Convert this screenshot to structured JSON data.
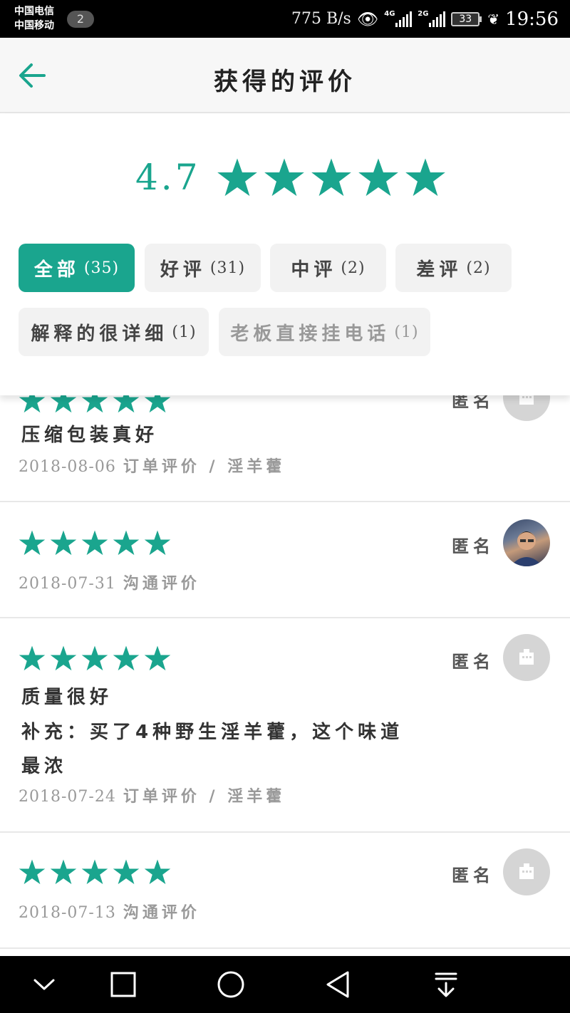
{
  "status_bar": {
    "carrier1": "中国电信",
    "carrier2": "中国移动",
    "notification_count": "2",
    "net_speed": "775 B/s",
    "signal1_tag": "4G",
    "signal2_tag": "2G",
    "battery": "33",
    "time": "19:56"
  },
  "header": {
    "title": "获得的评价"
  },
  "summary": {
    "rating": "4.7",
    "star_count": 5
  },
  "filters": [
    {
      "label": "全部",
      "count": "(35)",
      "active": true
    },
    {
      "label": "好评",
      "count": "(31)"
    },
    {
      "label": "中评",
      "count": "(2)"
    },
    {
      "label": "差评",
      "count": "(2)"
    },
    {
      "label": "解释的很详细",
      "count": "(1)"
    },
    {
      "label": "老板直接挂电话",
      "count": "(1)"
    }
  ],
  "reviews": [
    {
      "stars": 5,
      "name": "匿名",
      "comment": "压缩包装真好",
      "date": "2018-08-06",
      "type": "订单评价 / 淫羊藿"
    },
    {
      "stars": 5,
      "name": "匿名",
      "date": "2018-07-31",
      "type": "沟通评价"
    },
    {
      "stars": 5,
      "name": "匿名",
      "comment": "质量很好",
      "supplement": "补充：买了4种野生淫羊藿，这个味道最浓",
      "date": "2018-07-24",
      "type": "订单评价 / 淫羊藿"
    },
    {
      "stars": 5,
      "name": "匿名",
      "date": "2018-07-13",
      "type": "沟通评价"
    }
  ],
  "colors": {
    "accent": "#1aa58e",
    "chip_bg": "#f2f2f2"
  },
  "icons": [
    "back-arrow-icon",
    "star-icon",
    "avatar-placeholder-icon",
    "nav-collapse-icon",
    "nav-recent-icon",
    "nav-home-icon",
    "nav-back-icon",
    "nav-notification-icon"
  ]
}
